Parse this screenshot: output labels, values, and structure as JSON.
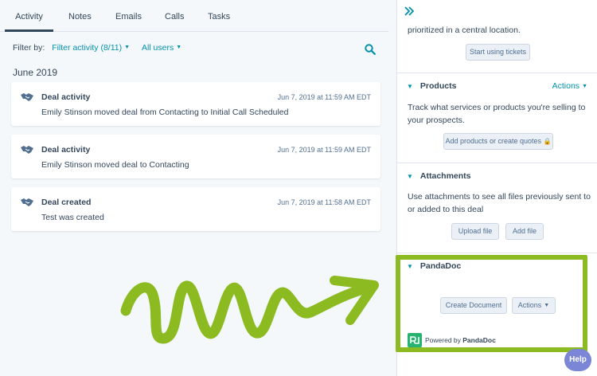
{
  "tabs": [
    {
      "label": "Activity",
      "active": true
    },
    {
      "label": "Notes"
    },
    {
      "label": "Emails"
    },
    {
      "label": "Calls"
    },
    {
      "label": "Tasks"
    }
  ],
  "filter": {
    "prefix": "Filter by:",
    "activity_filter": "Filter activity (8/11)",
    "users_filter": "All users"
  },
  "month": "June 2019",
  "activities": [
    {
      "title": "Deal activity",
      "time": "Jun 7, 2019 at 11:59 AM EDT",
      "desc": "Emily Stinson moved deal from Contacting to Initial Call Scheduled"
    },
    {
      "title": "Deal activity",
      "time": "Jun 7, 2019 at 11:59 AM EDT",
      "desc": "Emily Stinson moved deal to Contacting"
    },
    {
      "title": "Deal created",
      "time": "Jun 7, 2019 at 11:58 AM EDT",
      "desc": "Test was created"
    }
  ],
  "sidebar": {
    "tickets": {
      "text": "prioritized in a central location.",
      "button": "Start using tickets"
    },
    "products": {
      "title": "Products",
      "actions": "Actions",
      "text": "Track what services or products you're selling to your prospects.",
      "button": "Add products or create quotes"
    },
    "attachments": {
      "title": "Attachments",
      "text": "Use attachments to see all files previously sent to or added to this deal",
      "upload": "Upload file",
      "add": "Add file"
    },
    "pandadoc": {
      "title": "PandaDoc",
      "create": "Create Document",
      "actions": "Actions",
      "powered_prefix": "Powered by",
      "powered_brand": "PandaDoc"
    }
  },
  "help": "Help",
  "colors": {
    "accent": "#0091ae",
    "highlight": "#8cba21",
    "pandadoc_green": "#25b36f",
    "help_purple": "#7c86d6"
  }
}
